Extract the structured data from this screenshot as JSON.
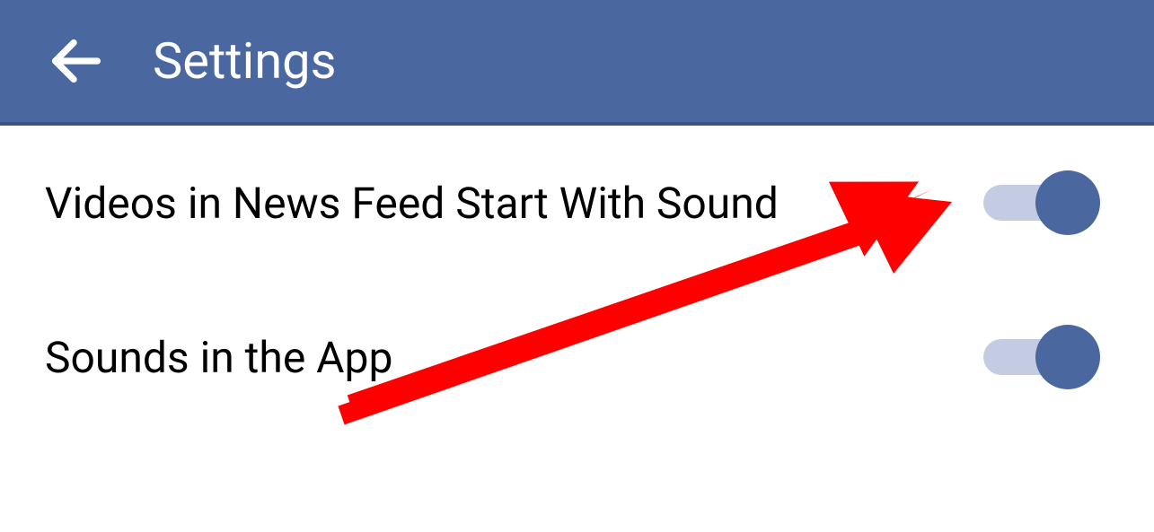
{
  "header": {
    "title": "Settings"
  },
  "settings": {
    "items": [
      {
        "label": "Videos in News Feed Start With Sound",
        "value": true
      },
      {
        "label": "Sounds in the App",
        "value": true
      }
    ]
  },
  "colors": {
    "header_bg": "#4a67a0",
    "toggle_thumb": "#4a67a0",
    "toggle_track": "#c3cce2",
    "annotation": "#ff0000"
  }
}
